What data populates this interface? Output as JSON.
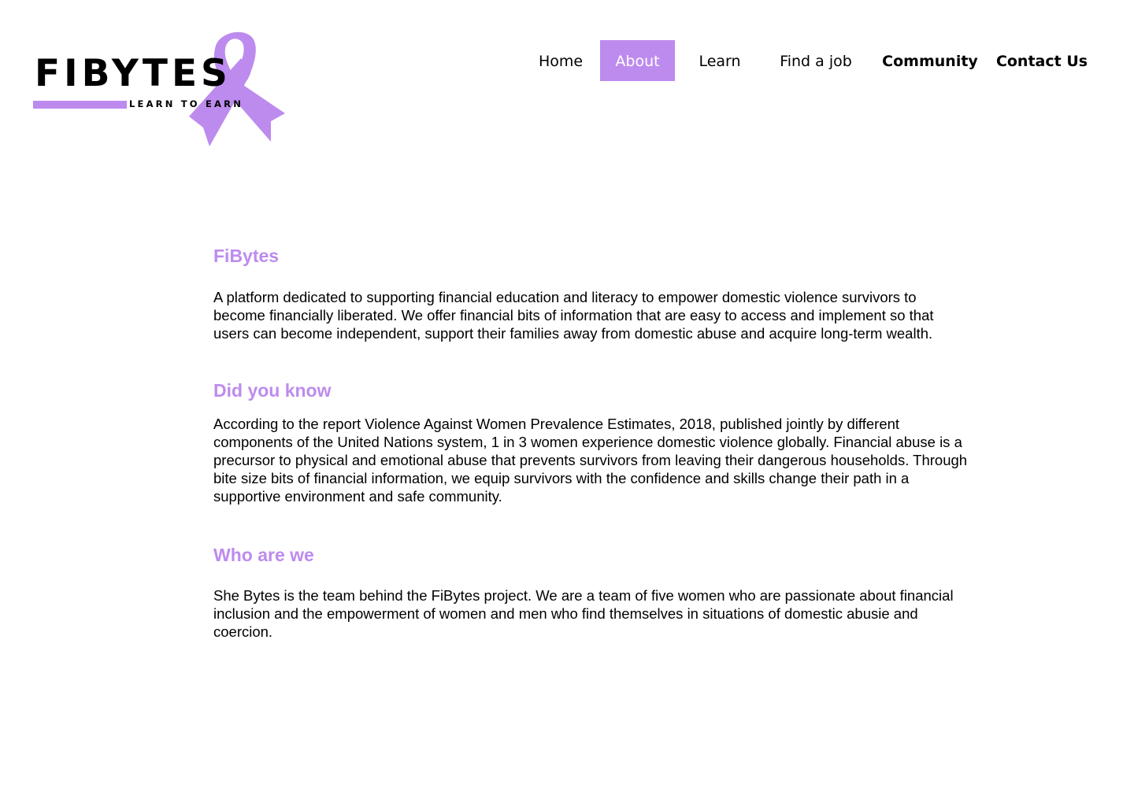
{
  "logo": {
    "wordmark": "FIBYTES",
    "tagline": "LEARN TO EARN",
    "icon": "awareness-ribbon-icon"
  },
  "nav": {
    "items": [
      {
        "label": "Home",
        "active": false
      },
      {
        "label": "About",
        "active": true
      },
      {
        "label": "Learn",
        "active": false
      },
      {
        "label": "Find a job",
        "active": false
      },
      {
        "label": "Community",
        "active": false
      },
      {
        "label": "Contact Us",
        "active": false
      }
    ]
  },
  "sections": [
    {
      "title": "FiBytes",
      "text": "A platform dedicated to supporting financial education and literacy to empower domestic violence survivors to become financially liberated. We offer financial bits of information that are easy to access and implement so that users can become independent, support their families away from domestic abuse and acquire long-term wealth."
    },
    {
      "title": "Did you know",
      "text": "According to the report Violence Against Women Prevalence Estimates, 2018, published jointly by different components of the United Nations system, 1 in 3 women experience domestic violence globally. Financial abuse is a precursor to physical and emotional abuse that prevents survivors from leaving their dangerous households. Through bite size bits of financial information, we equip survivors with the confidence and skills change their path in a supportive environment and safe community."
    },
    {
      "title": "Who are we",
      "text": "She Bytes is the team behind the FiBytes project. We are a team of five women who are passionate about financial inclusion and the empowerment of women and men who find themselves in situations of domestic abusie and coercion."
    }
  ],
  "colors": {
    "accent": "#bd8bee",
    "text": "#000000",
    "background": "#ffffff"
  }
}
